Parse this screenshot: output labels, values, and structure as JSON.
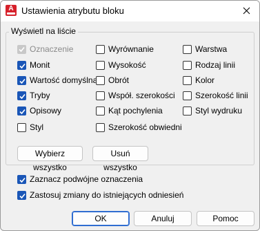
{
  "window": {
    "title": "Ustawienia atrybutu bloku",
    "app_icon_letter": "A",
    "close_icon": "close-icon"
  },
  "group": {
    "legend": "Wyświetl na liście"
  },
  "columns": [
    [
      {
        "label": "Oznaczenie",
        "checked": true,
        "disabled": true
      },
      {
        "label": "Monit",
        "checked": true
      },
      {
        "label": "Wartość domyślna",
        "checked": true
      },
      {
        "label": "Tryby",
        "checked": true
      },
      {
        "label": "Opisowy",
        "checked": true
      },
      {
        "label": "Styl",
        "checked": false
      }
    ],
    [
      {
        "label": "Wyrównanie",
        "checked": false
      },
      {
        "label": "Wysokość",
        "checked": false
      },
      {
        "label": "Obrót",
        "checked": false
      },
      {
        "label": "Współ. szerokości",
        "checked": false
      },
      {
        "label": "Kąt pochylenia",
        "checked": false
      },
      {
        "label": "Szerokość obwiedni",
        "checked": false
      }
    ],
    [
      {
        "label": "Warstwa",
        "checked": false
      },
      {
        "label": "Rodzaj linii",
        "checked": false
      },
      {
        "label": "Kolor",
        "checked": false
      },
      {
        "label": "Szerokość linii",
        "checked": false
      },
      {
        "label": "Styl wydruku",
        "checked": false
      }
    ]
  ],
  "buttons": {
    "select_all": "Wybierz wszystko",
    "clear_all": "Usuń wszystko",
    "ok": "OK",
    "cancel": "Anuluj",
    "help": "Pomoc"
  },
  "options": [
    {
      "label": "Zaznacz podwójne oznaczenia",
      "checked": true
    },
    {
      "label": "Zastosuj zmiany do istniejących odniesień",
      "checked": true
    }
  ],
  "colors": {
    "accent": "#1a56b7",
    "app_icon": "#d6202a"
  }
}
